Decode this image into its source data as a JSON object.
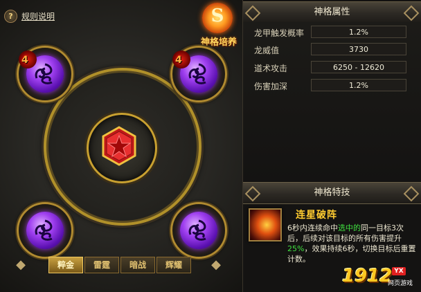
{
  "left_panel": {
    "rules_label": "规则说明",
    "help_icon_glyph": "?",
    "emblem_glyph": "S",
    "emblem_title": "神格培养",
    "slots": [
      {
        "position": "top-left",
        "level": "4"
      },
      {
        "position": "top-right",
        "level": "4"
      },
      {
        "position": "bottom-left",
        "level": ""
      },
      {
        "position": "bottom-right",
        "level": ""
      }
    ],
    "tabs": [
      {
        "label": "粹金",
        "active": true
      },
      {
        "label": "雷霆",
        "active": false
      },
      {
        "label": "暗战",
        "active": false
      },
      {
        "label": "辉耀",
        "active": false
      }
    ],
    "prev_arrow": "◆",
    "next_arrow": "◆"
  },
  "attributes": {
    "header": "神格属性",
    "rows": [
      {
        "label": "龙甲触发概率",
        "value": "1.2%"
      },
      {
        "label": "龙威值",
        "value": "3730"
      },
      {
        "label": "道术攻击",
        "value": "6250 - 12620"
      },
      {
        "label": "伤害加深",
        "value": "1.2%"
      }
    ]
  },
  "skill": {
    "header": "神格特技",
    "name": "连星破阵",
    "desc_1": "6秒内连续命中",
    "desc_hl_1": "选中的",
    "desc_2": "同一目标3次后，后续对该目标的所有伤害提升",
    "desc_hl_2": "25%",
    "desc_3": "，效果持续6秒，切换目标后重置计数。"
  },
  "logo": {
    "number": "1912",
    "badge": "YX",
    "sub": "网页游戏"
  },
  "colors": {
    "accent_gold": "#c8a030",
    "highlight_green": "#40e040",
    "skill_name": "#ffcc30"
  }
}
